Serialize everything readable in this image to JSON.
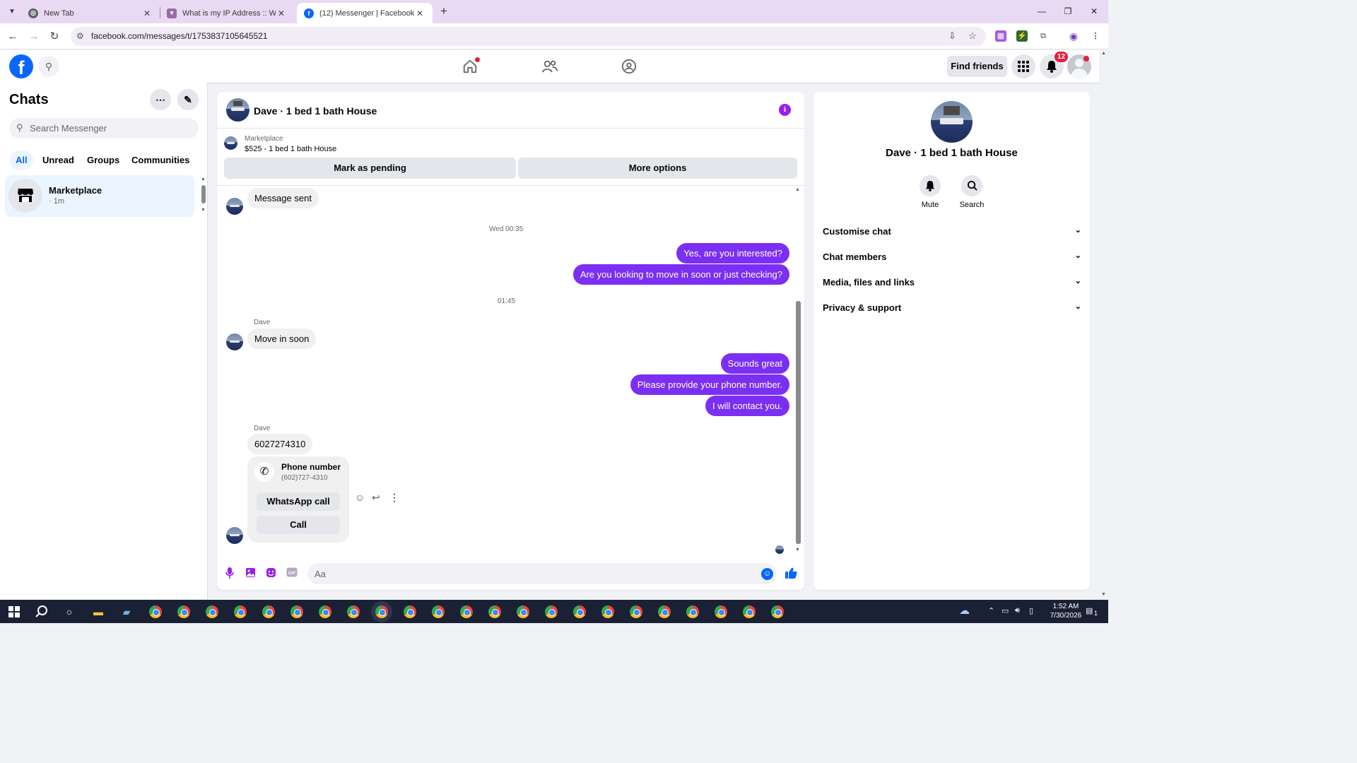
{
  "browser": {
    "tabs": [
      {
        "title": "New Tab",
        "active": false
      },
      {
        "title": "What is my IP Address :: WebBrowserTools",
        "active": false
      },
      {
        "title": "(12) Messenger | Facebook",
        "active": true
      }
    ],
    "url": "facebook.com/messages/t/1753837105645521"
  },
  "fb": {
    "logo": "f",
    "find_friends": "Find friends",
    "notification_count": "12"
  },
  "chats": {
    "title": "Chats",
    "search_placeholder": "Search Messenger",
    "filters": [
      "All",
      "Unread",
      "Groups",
      "Communities"
    ],
    "active_filter": "All",
    "items": [
      {
        "name": "Marketplace",
        "time": "· 1m"
      }
    ]
  },
  "conversation": {
    "title": "Dave · 1 bed 1 bath House",
    "marketplace_label": "Marketplace",
    "listing": "$525 - 1 bed 1 bath House",
    "mark_pending": "Mark as pending",
    "more_options": "More options",
    "messages": {
      "sent_receipt": "Message sent",
      "ts1": "Wed 00:35",
      "out1": "Yes, are you interested?",
      "out2": "Are you looking to move in soon or just checking?",
      "ts2": "01:45",
      "sender1": "Dave",
      "in1": "Move in soon",
      "out3": "Sounds great",
      "out4": "Please provide your phone number.",
      "out5": "I will contact you.",
      "sender2": "Dave",
      "in2": "6027274310"
    },
    "phone_card": {
      "title": "Phone number",
      "number": "(602)727-4310",
      "whatsapp": "WhatsApp call",
      "call": "Call"
    },
    "composer_placeholder": "Aa"
  },
  "info_panel": {
    "name": "Dave · 1 bed 1 bath House",
    "actions": [
      "Mute",
      "Search"
    ],
    "sections": [
      "Customise chat",
      "Chat members",
      "Media, files and links",
      "Privacy & support"
    ]
  },
  "taskbar": {
    "time": "1:52 AM",
    "date": "7/30/2026",
    "notification_count": "1"
  },
  "colors": {
    "accent_purple": "#7b2ff2",
    "fb_blue": "#0866ff",
    "badge_red": "#e41e3f"
  }
}
